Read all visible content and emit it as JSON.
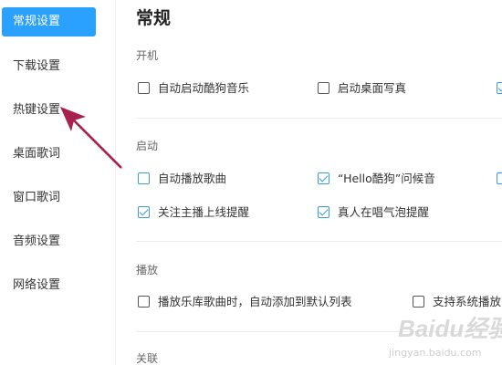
{
  "sidebar": {
    "items": [
      {
        "label": "常规设置"
      },
      {
        "label": "下载设置"
      },
      {
        "label": "热键设置"
      },
      {
        "label": "桌面歌词"
      },
      {
        "label": "窗口歌词"
      },
      {
        "label": "音频设置"
      },
      {
        "label": "网络设置"
      }
    ]
  },
  "main": {
    "title": "常规",
    "sections": {
      "startup": {
        "title": "开机",
        "options": [
          {
            "label": "自动启动酷狗音乐",
            "checked": false
          },
          {
            "label": "启动桌面写真",
            "checked": false
          }
        ]
      },
      "launch": {
        "title": "启动",
        "options": [
          {
            "label": "自动播放歌曲",
            "checked": false
          },
          {
            "label": "“Hello酷狗”问候音",
            "checked": true
          },
          {
            "label": "关注主播上线提醒",
            "checked": true
          },
          {
            "label": "真人在唱气泡提醒",
            "checked": true
          }
        ]
      },
      "playback": {
        "title": "播放",
        "options": [
          {
            "label": "播放乐库歌曲时，自动添加到默认列表",
            "checked": false
          },
          {
            "label": "支持系统播放",
            "checked": false
          }
        ]
      },
      "association": {
        "title": "关联"
      }
    }
  },
  "watermark": {
    "text": "Baidu经验",
    "sub": "jingyan.baidu.com"
  },
  "colors": {
    "accent": "#2aa0ff",
    "annotation_arrow": "#a8204e"
  }
}
